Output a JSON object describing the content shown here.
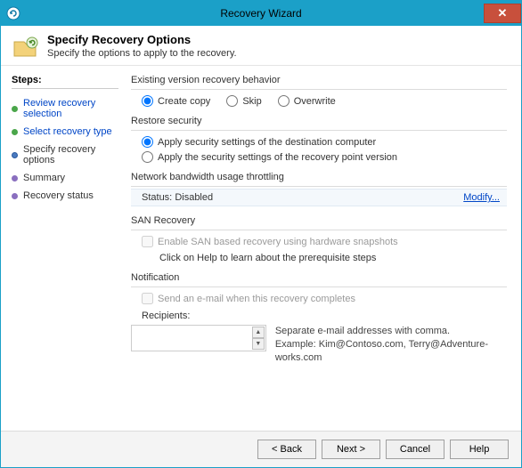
{
  "window": {
    "title": "Recovery Wizard",
    "close_glyph": "✕"
  },
  "header": {
    "title": "Specify Recovery Options",
    "subtitle": "Specify the options to apply to the recovery."
  },
  "steps": {
    "heading": "Steps:",
    "items": [
      {
        "label": "Review recovery selection",
        "state": "done",
        "link": true
      },
      {
        "label": "Select recovery type",
        "state": "done",
        "link": true
      },
      {
        "label": "Specify recovery options",
        "state": "current",
        "link": false
      },
      {
        "label": "Summary",
        "state": "todo",
        "link": false
      },
      {
        "label": "Recovery status",
        "state": "todo",
        "link": false
      }
    ]
  },
  "content": {
    "existing_version": {
      "label": "Existing version recovery behavior",
      "options": {
        "create_copy": "Create copy",
        "skip": "Skip",
        "overwrite": "Overwrite"
      },
      "selected": "create_copy"
    },
    "restore_security": {
      "label": "Restore security",
      "options": {
        "dest": "Apply security settings of the destination computer",
        "point": "Apply the security settings of the recovery point version"
      },
      "selected": "dest"
    },
    "throttling": {
      "label": "Network bandwidth usage throttling",
      "status_prefix": "Status:",
      "status_value": "Disabled",
      "modify": "Modify..."
    },
    "san": {
      "label": "SAN Recovery",
      "checkbox": "Enable SAN based recovery using hardware snapshots",
      "help": "Click on Help to learn about the prerequisite steps"
    },
    "notification": {
      "label": "Notification",
      "checkbox": "Send an e-mail when this recovery completes",
      "recipients_label": "Recipients:",
      "help1": "Separate e-mail addresses with comma.",
      "help2": "Example: Kim@Contoso.com, Terry@Adventure-works.com"
    }
  },
  "footer": {
    "back": "< Back",
    "next": "Next >",
    "cancel": "Cancel",
    "help": "Help"
  }
}
